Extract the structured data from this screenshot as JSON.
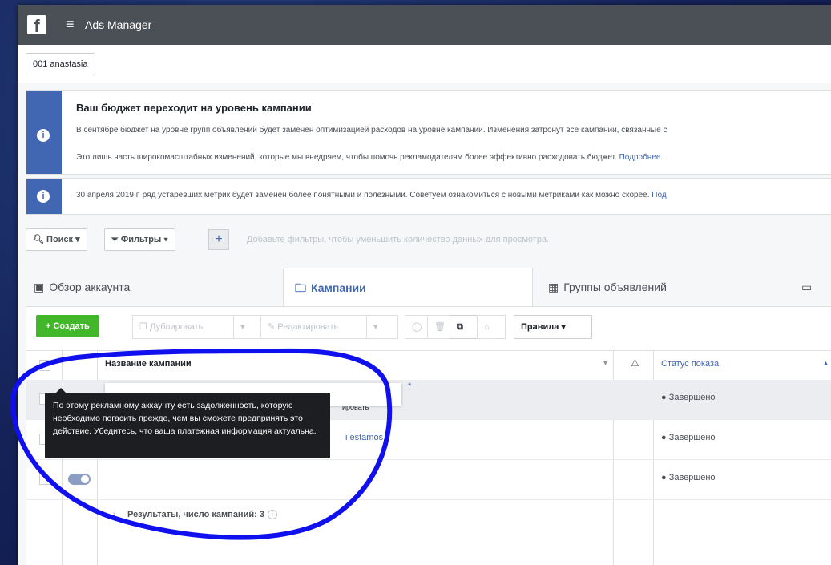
{
  "colors": {
    "topbar": "#4b4f56",
    "accent": "#4267b2",
    "create": "#42b72a",
    "annotation": "#1010ee"
  },
  "topbar": {
    "logo": "f",
    "menu_icon": "hamburger-icon",
    "title": "Ads Manager"
  },
  "account": {
    "name": "001 anastasia"
  },
  "notices": [
    {
      "icon": "info-icon",
      "title": "Ваш бюджет переходит на уровень кампании",
      "line1": "В сентябре бюджет на уровне групп объявлений будет заменен оптимизацией расходов на уровне кампании. Изменения затронут все кампании, связанные с",
      "line2": "Это лишь часть широкомасштабных изменений, которые мы внедряем, чтобы помочь рекламодателям более эффективно расходовать бюджет.",
      "link": "Подробнее."
    },
    {
      "icon": "info-icon",
      "text": "30 апреля 2019 г. ряд устаревших метрик будет заменен более понятными и полезными. Советуем ознакомиться с новыми метриками как можно скорее.",
      "link": "Под"
    }
  ],
  "filters": {
    "search": "Поиск ▾",
    "filters": "Фильтры ▾",
    "add": "+",
    "hint": "Добавьте фильтры, чтобы уменьшить количество данных для просмотра."
  },
  "tabs": [
    {
      "label": "Обзор аккаунта",
      "icon": "account-overview-icon"
    },
    {
      "label": "Кампании",
      "icon": "campaigns-folder-icon"
    },
    {
      "label": "Группы объявлений",
      "icon": "ad-sets-grid-icon"
    }
  ],
  "toolbar": {
    "create": "+ Создать",
    "duplicate": "Дублировать",
    "edit": "Редактировать",
    "rules": "Правила ▾"
  },
  "table": {
    "col_name": "Название кампании",
    "col_status": "Статус показа",
    "rows": [
      {
        "status": "● Завершено"
      },
      {
        "status": "● Завершено",
        "name_fragment": "i estamos"
      },
      {
        "status": "● Завершено"
      }
    ],
    "results": "Результаты, число кампаний: 3",
    "duplicate_fragment": "ировать"
  },
  "tooltip": {
    "text": "По этому рекламному аккаунту есть задолженность, которую необходимо погасить прежде, чем вы сможете предпринять это действие. Убедитесь, что ваша платежная информация актуальна."
  }
}
